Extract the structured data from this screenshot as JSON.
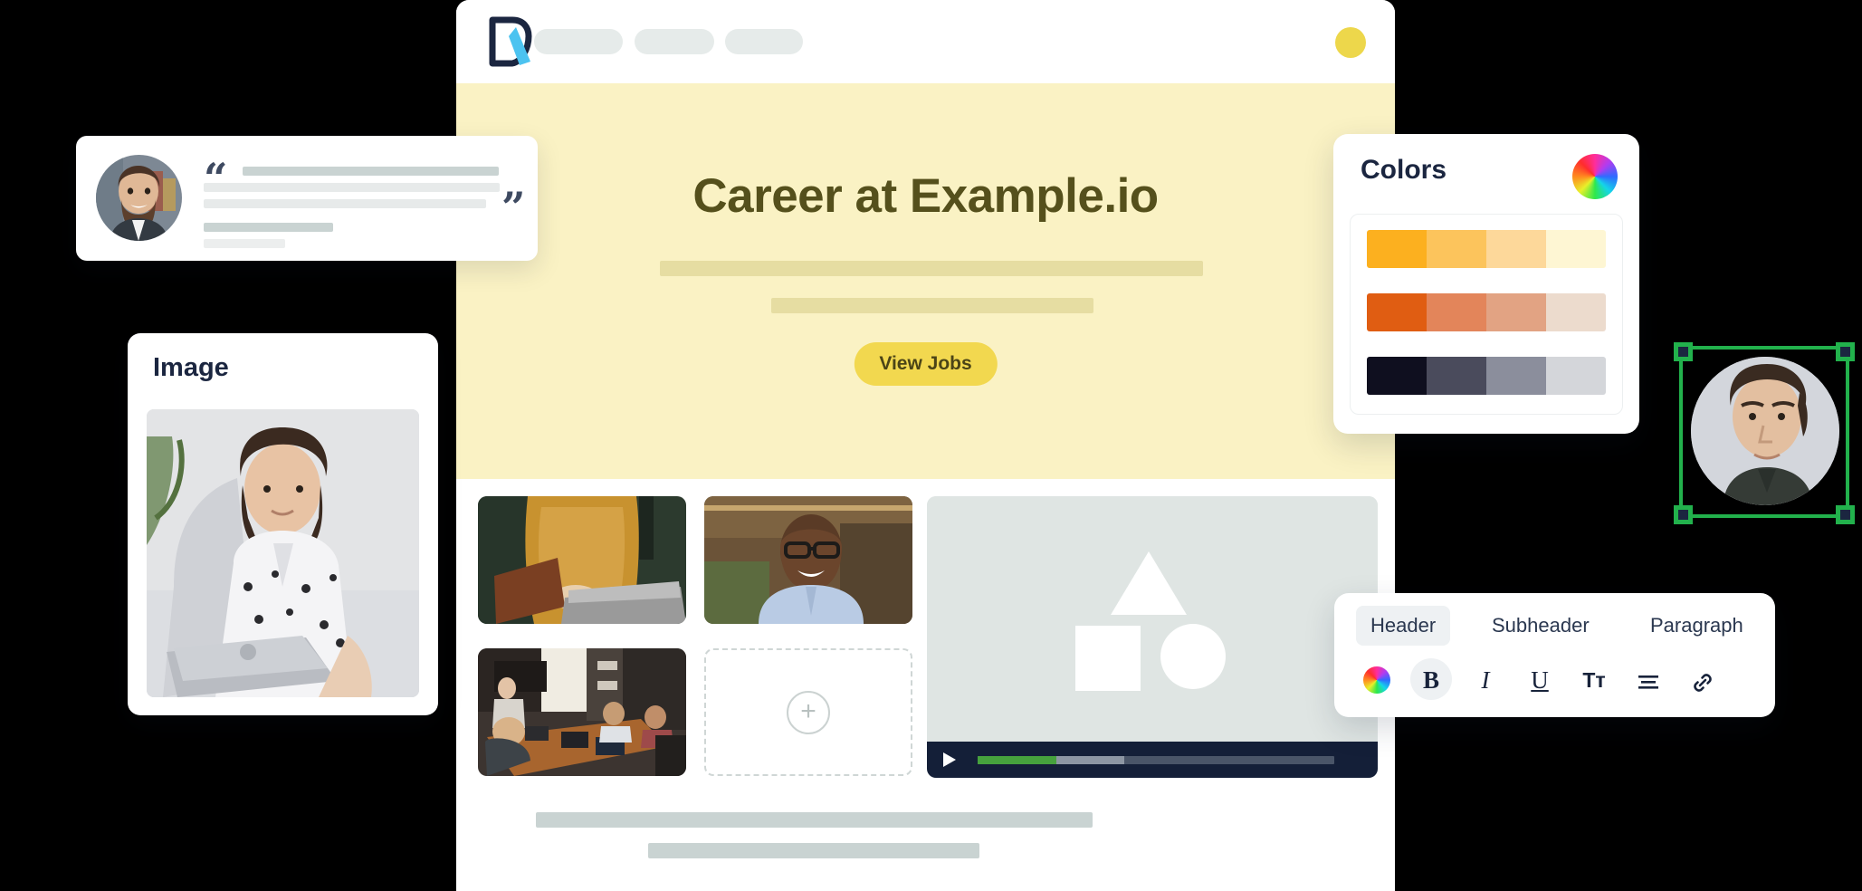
{
  "browser": {
    "logo_icon": "document-pen-logo",
    "logo_colors": {
      "outline": "#1b2640",
      "accent": "#4cc3f0"
    },
    "nav_placeholders": 3,
    "account_avatar_color": "#edd74b"
  },
  "hero": {
    "title": "Career at Example.io",
    "background": "#faf2c4",
    "title_color": "#55501c",
    "subtitle_placeholder_bars": 2,
    "cta_label": "View Jobs",
    "cta_background": "#f2d84f",
    "cta_text_color": "#4b4417"
  },
  "content": {
    "tiles": [
      {
        "name": "tile-laptop",
        "alt": "person in mustard sweater typing on laptop"
      },
      {
        "name": "tile-smiling",
        "alt": "smiling man with glasses in blue shirt"
      },
      {
        "name": "tile-meeting",
        "alt": "conference room meeting with laptops"
      }
    ],
    "add_tile": {
      "icon": "plus-icon",
      "label": "+"
    },
    "video": {
      "shapes": [
        "triangle",
        "square",
        "circle"
      ],
      "play_icon": "play-icon",
      "progress_played_pct": 22,
      "progress_buffered_pct": 41,
      "played_color": "#46a23d",
      "buffer_color": "#8d96a3",
      "track_color": "#4a5568",
      "controls_background": "#141f38"
    },
    "body_placeholder_bars": 2
  },
  "testimonial": {
    "avatar_alt": "bearded man in suit headshot",
    "quote_open": "“",
    "quote_close": "”",
    "placeholder_lines": 5
  },
  "image_card": {
    "title": "Image",
    "photo_alt": "woman in polka dot blouse working on laptop"
  },
  "colors_panel": {
    "title": "Colors",
    "wheel_icon": "color-wheel-icon",
    "swatch_rows": [
      {
        "name": "amber-scale",
        "colors": [
          "#fcb01f",
          "#fcc45c",
          "#fdd89a",
          "#fef6d3"
        ]
      },
      {
        "name": "orange-scale",
        "colors": [
          "#e05d12",
          "#e3855a",
          "#e2a383",
          "#ecdbcd"
        ]
      },
      {
        "name": "neutral-scale",
        "colors": [
          "#0f0f1f",
          "#4a4b5c",
          "#8b8e9c",
          "#d4d6da"
        ]
      }
    ]
  },
  "selected_avatar": {
    "photo_alt": "young man headshot on gray background",
    "selection_color": "#22b14c",
    "handle_count": 4,
    "selected": true
  },
  "text_toolbar": {
    "style_tabs": [
      {
        "label": "Header",
        "active": true
      },
      {
        "label": "Subheader",
        "active": false
      },
      {
        "label": "Paragraph",
        "active": false
      }
    ],
    "format_buttons": [
      {
        "name": "text-color",
        "glyph": "",
        "icon": "color-wheel-icon",
        "active": false
      },
      {
        "name": "bold",
        "glyph": "B",
        "active": true
      },
      {
        "name": "italic",
        "glyph": "I",
        "active": false
      },
      {
        "name": "underline",
        "glyph": "U",
        "active": false
      },
      {
        "name": "font-size",
        "glyph": "Tᴛ",
        "active": false
      },
      {
        "name": "align",
        "glyph": "☰",
        "active": false
      },
      {
        "name": "link",
        "glyph": "🔗",
        "active": false
      }
    ]
  }
}
